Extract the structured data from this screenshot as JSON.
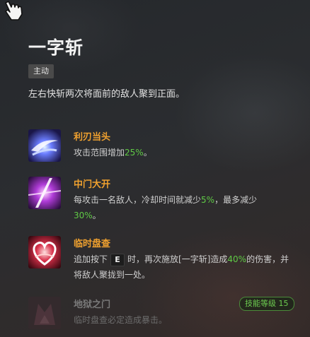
{
  "skill": {
    "title": "一字斩",
    "tag": "主动",
    "description": "左右快斩两次将面前的敌人聚到正面。"
  },
  "abilities": [
    {
      "name": "利刃当头",
      "text_a": "攻击范围增加",
      "value": "25%",
      "text_b": "。",
      "icon": "blade-swirl-icon"
    },
    {
      "name": "中门大开",
      "text_a": "每攻击一名敌人，冷却时间就减少",
      "value": "5%",
      "text_b": "，最多减少",
      "value2": "30%",
      "text_c": "。",
      "icon": "light-slash-icon"
    },
    {
      "name": "临时盘查",
      "text_pre": "追加按下",
      "key": "E",
      "text_a": "时，再次施放[一字斩]造成",
      "value": "40%",
      "text_b": "的伤害，并将敌人聚拢到一处。",
      "icon": "heart-clamp-icon"
    },
    {
      "name": "地狱之门",
      "text_a": "临时盘查必定造成暴击。",
      "badge": "技能等级 15",
      "icon": "hell-gate-icon",
      "locked": true
    }
  ],
  "colors": {
    "accent_orange": "#f0a12f",
    "value_green": "#5fca45",
    "badge_green": "#6ccb4f"
  }
}
